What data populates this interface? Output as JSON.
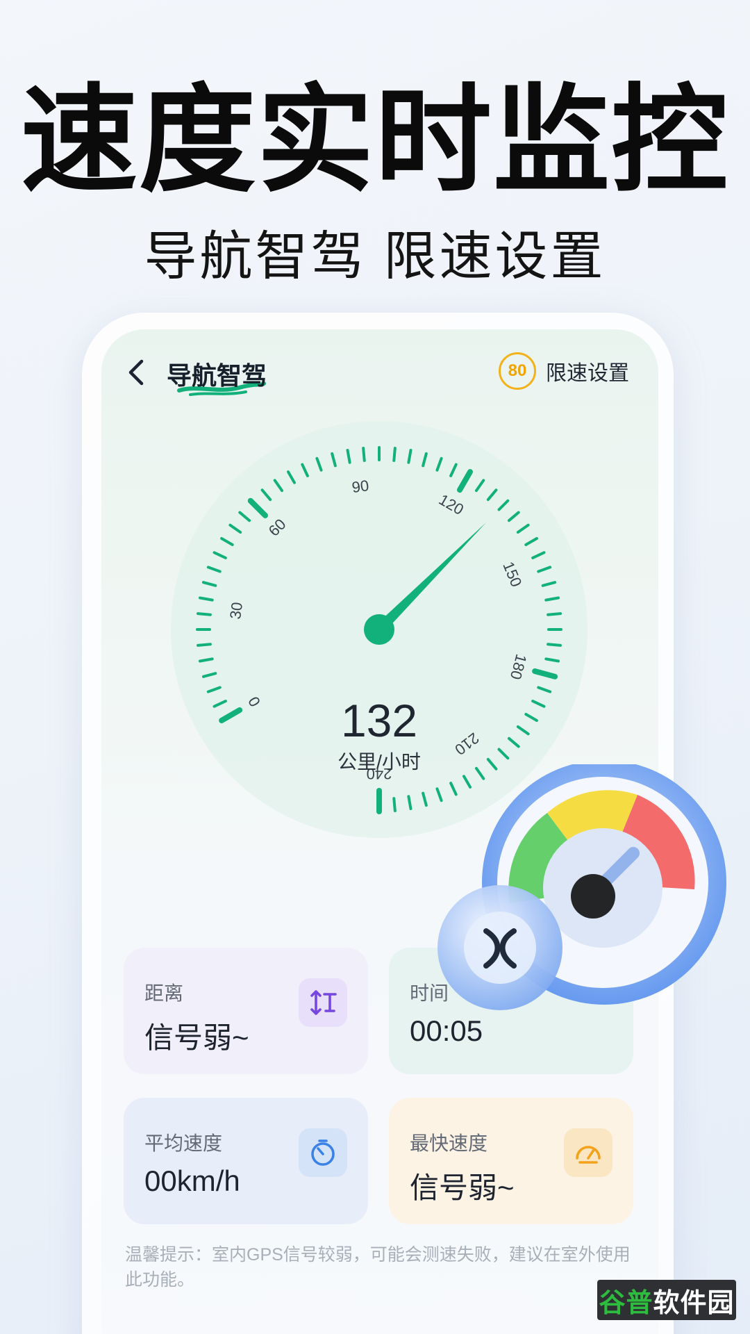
{
  "hero": {
    "title": "速度实时监控",
    "subtitle": "导航智驾  限速设置"
  },
  "topbar": {
    "title": "导航智驾",
    "limit_value": "80",
    "limit_label": "限速设置"
  },
  "gauge": {
    "tick_labels": [
      "0",
      "30",
      "60",
      "90",
      "120",
      "150",
      "180",
      "210",
      "240"
    ],
    "min": 0,
    "max": 240,
    "needle_value": 132,
    "speed_value": "132",
    "speed_unit": "公里/小时",
    "accent_color": "#12b07a"
  },
  "stats": [
    {
      "label": "距离",
      "value": "信号弱~",
      "icon": "distance-icon",
      "bg": "#f1eff9",
      "icon_bg": "#e8e0fb",
      "icon_color": "#7647e0"
    },
    {
      "label": "时间",
      "value": "00:05",
      "icon": "clock-icon",
      "bg": "#e7f3f0",
      "icon_bg": "#d5ece5",
      "icon_color": "#12b07a"
    },
    {
      "label": "平均速度",
      "value": "00km/h",
      "icon": "timer-icon",
      "bg": "#e8eef9",
      "icon_bg": "#d5e3f8",
      "icon_color": "#3b82e6"
    },
    {
      "label": "最快速度",
      "value": "信号弱~",
      "icon": "speedometer-icon",
      "bg": "#fcf3e4",
      "icon_bg": "#fbe6c4",
      "icon_color": "#f3a21c"
    }
  ],
  "tip": "温馨提示：室内GPS信号较弱，可能会测速失败，建议在室外使用此功能。",
  "watermark": {
    "part1": "谷普",
    "part2": "软件园"
  }
}
